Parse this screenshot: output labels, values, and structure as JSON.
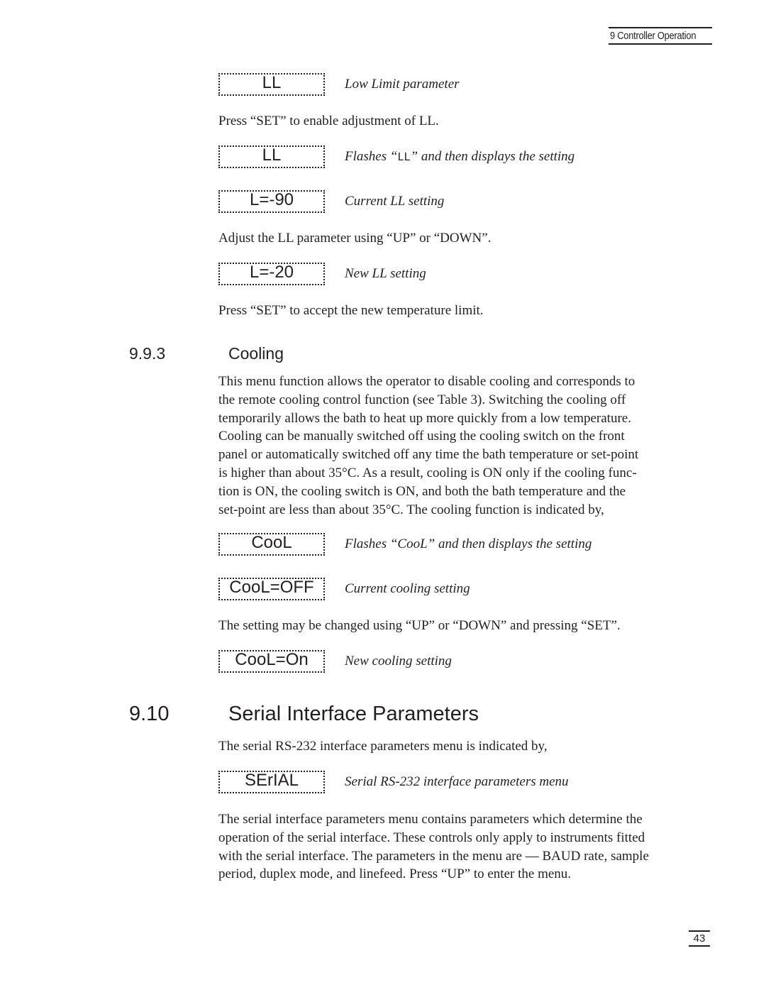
{
  "header": {
    "running_title": "9 Controller Operation"
  },
  "low_limit": {
    "display_1": {
      "lcd": "LL",
      "caption": "Low Limit parameter"
    },
    "instruction_1": "Press “SET” to enable adjustment of LL.",
    "display_2": {
      "lcd": "LL",
      "caption_prefix": "Flashes “",
      "caption_code": "LL",
      "caption_suffix": "” and then displays the setting"
    },
    "display_3": {
      "lcd": "L=-90",
      "caption": "Current LL setting"
    },
    "instruction_2": "Adjust the LL parameter using “UP” or “DOWN”.",
    "display_4": {
      "lcd": "L=-20",
      "caption": "New LL setting"
    },
    "instruction_3": "Press “SET” to accept the new temperature limit."
  },
  "cooling": {
    "number": "9.9.3",
    "title": "Cooling",
    "paragraph_lines": [
      "This menu function allows the operator to disable cooling and corresponds to",
      "the remote cooling control function (see Table 3). Switching the cooling off",
      "temporarily allows the bath to heat up more quickly from a low temperature.",
      "Cooling can be manually switched off using the cooling switch on the front",
      "panel or automatically switched off any time the bath temperature or set-point",
      "is higher than about 35°C. As a result, cooling is ON only if the cooling func-",
      "tion is ON, the cooling switch is ON, and both the bath temperature and the",
      "set-point are less than about 35°C. The cooling function is indicated by,"
    ],
    "display_1": {
      "lcd": "CooL",
      "caption": "Flashes “CooL” and then displays the setting"
    },
    "display_2": {
      "lcd": "CooL=OFF",
      "caption": "Current cooling setting"
    },
    "instruction": "The setting may be changed using “UP” or “DOWN” and pressing “SET”.",
    "display_3": {
      "lcd": "CooL=On",
      "caption": "New cooling setting"
    }
  },
  "serial": {
    "number": "9.10",
    "title": "Serial Interface Parameters",
    "intro": "The serial RS-232 interface parameters menu is indicated by,",
    "display_1": {
      "lcd": "SErIAL",
      "caption": "Serial RS-232 interface parameters menu"
    },
    "paragraph_lines": [
      "The serial interface parameters menu contains parameters which determine the",
      "operation of the serial interface. These controls only apply to instruments fitted",
      "with the serial interface. The parameters in the menu are — BAUD rate, sample",
      "period, duplex mode, and linefeed. Press “UP” to enter the menu."
    ]
  },
  "footer": {
    "page_number": "43"
  }
}
